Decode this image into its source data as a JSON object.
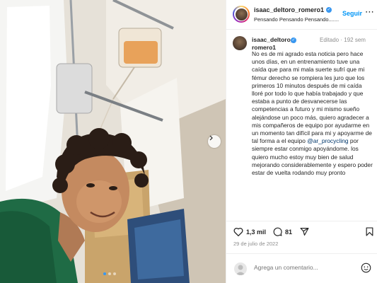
{
  "post": {
    "username": "isaac_deltoro_romero1",
    "subtitle": "Pensando Pensando Pensando.......",
    "follow_label": "Seguir",
    "more_label": "⋯",
    "caption_username": "isaac_deltoro_romero1",
    "caption_meta": "Editado · 192 sem",
    "caption_part1": "No es de mi agrado esta noticia pero hace unos días, en un entrenamiento tuve una caída que para mi mala suerte sufrí que mi fémur derecho se rompiera les juro que los primeros 10 minutos después de mi caída lloré por todo lo que había trabajado y que estaba a punto de desvanecerse las competencias a futuro y mi mismo sueño alejándose un poco más, quiero agradecer a mis compañeros de equipo por ayudarme en un momento tan difícil para mi y apoyarme de tal forma a el equipo ",
    "caption_mention": "@ar_procycling",
    "caption_part2": " por siempre estar conmigo apoyándome.  los quiero mucho estoy muy bien de salud mejorando considerablemente y espero poder estar de vuelta rodando muy pronto",
    "likes": "1,3 mil",
    "comments": "81",
    "date": "29 de julio de 2022",
    "comment_placeholder": "Agrega un comentario...",
    "carousel": {
      "total": 3,
      "active_index": 0
    }
  },
  "icons": {
    "verified": "verified-badge-icon",
    "like": "heart-icon",
    "comment": "comment-icon",
    "share": "share-icon",
    "save": "bookmark-icon",
    "next": "chevron-right-icon",
    "emoji": "emoji-icon",
    "more": "more-options-icon"
  },
  "colors": {
    "accent": "#0095f6",
    "verified": "#3897f0",
    "muted": "#8e8e8e",
    "link": "#00376b"
  }
}
